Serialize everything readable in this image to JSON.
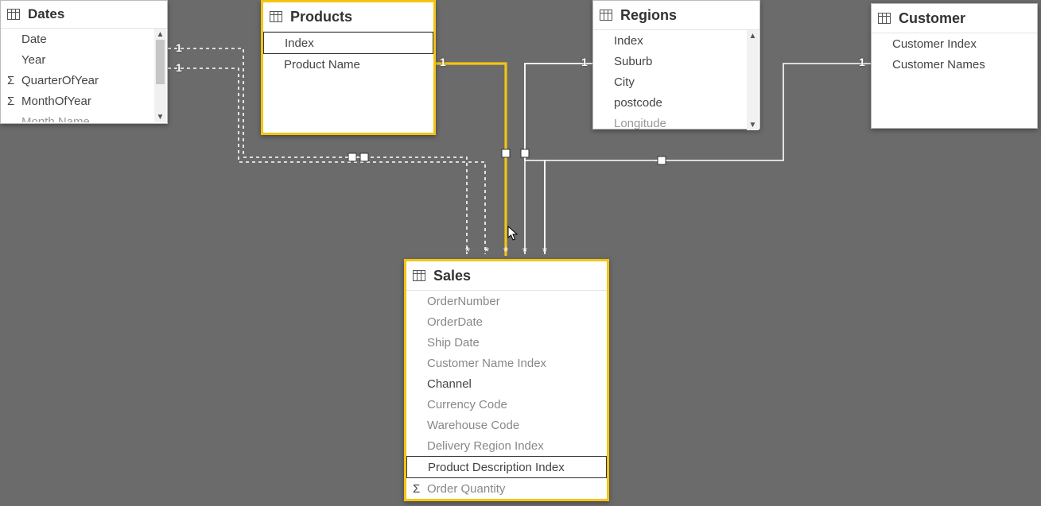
{
  "tables": {
    "dates": {
      "title": "Dates",
      "fields": {
        "date": {
          "label": "Date"
        },
        "year": {
          "label": "Year"
        },
        "qoy": {
          "label": "QuarterOfYear",
          "agg": true
        },
        "moy": {
          "label": "MonthOfYear",
          "agg": true
        },
        "mname": {
          "label": "Month Name"
        }
      }
    },
    "products": {
      "title": "Products",
      "fields": {
        "index": {
          "label": "Index"
        },
        "pname": {
          "label": "Product Name"
        }
      }
    },
    "regions": {
      "title": "Regions",
      "fields": {
        "index": {
          "label": "Index"
        },
        "suburb": {
          "label": "Suburb"
        },
        "city": {
          "label": "City"
        },
        "postcode": {
          "label": "postcode"
        },
        "lon": {
          "label": "Longitude"
        }
      }
    },
    "customer": {
      "title": "Customer",
      "fields": {
        "cidx": {
          "label": "Customer Index"
        },
        "cnames": {
          "label": "Customer Names"
        }
      }
    },
    "sales": {
      "title": "Sales",
      "fields": {
        "ordernum": {
          "label": "OrderNumber"
        },
        "orderdate": {
          "label": "OrderDate"
        },
        "shipdate": {
          "label": "Ship Date"
        },
        "cni": {
          "label": "Customer Name Index"
        },
        "channel": {
          "label": "Channel"
        },
        "ccode": {
          "label": "Currency Code"
        },
        "wcode": {
          "label": "Warehouse Code"
        },
        "dri": {
          "label": "Delivery Region Index"
        },
        "pdi": {
          "label": "Product Description Index"
        },
        "oqty": {
          "label": "Order Quantity",
          "agg": true
        }
      }
    }
  },
  "relationships": {
    "endpoints_one": [
      "1",
      "1",
      "1",
      "1",
      "1"
    ],
    "endpoints_many_symbol": "*"
  }
}
